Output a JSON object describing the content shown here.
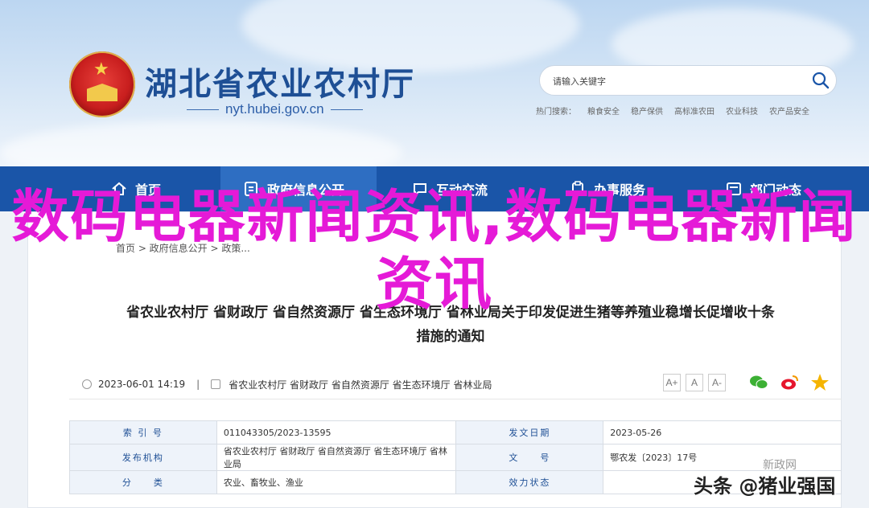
{
  "header": {
    "site_title": "湖北省农业农村厅",
    "domain": "nyt.hubei.gov.cn",
    "search_placeholder": "请输入关键字",
    "hot_search_label": "热门搜索：",
    "hot_search_items": [
      "粮食安全",
      "稳产保供",
      "高标准农田",
      "农业科技",
      "农产品安全"
    ]
  },
  "nav": {
    "items": [
      {
        "label": "首页"
      },
      {
        "label": "政府信息公开"
      },
      {
        "label": "互动交流"
      },
      {
        "label": "办事服务"
      },
      {
        "label": "部门动态"
      }
    ]
  },
  "breadcrumb": "首页 > 政府信息公开 > 政策...",
  "article": {
    "title_line1": "省农业农村厅 省财政厅 省自然资源厅 省生态环境厅 省林业局关于印发促进生猪等养殖业稳增长促增收十条",
    "title_line2": "措施的通知",
    "date": "2023-06-01 14:19",
    "divider": "|",
    "publishers": "省农业农村厅 省财政厅 省自然资源厅 省生态环境厅 省林业局",
    "font_buttons": [
      "A+",
      "A",
      "A-"
    ]
  },
  "info_table": [
    {
      "label1": "索 引 号",
      "value1": "011043305/2023-13595",
      "label2": "发文日期",
      "value2": "2023-05-26"
    },
    {
      "label1": "发布机构",
      "value1": "省农业农村厅 省财政厅 省自然资源厅 省生态环境厅 省林业局",
      "label2": "文　　号",
      "value2": "鄂农发〔2023〕17号"
    },
    {
      "label1": "分　　类",
      "value1": "农业、畜牧业、渔业",
      "label2": "效力状态",
      "value2": ""
    }
  ],
  "overlay_title": "数码电器新闻资讯,数码电器新闻资讯",
  "watermark_small": "新政网",
  "watermark": "头条 @猪业强国",
  "colors": {
    "nav_bg": "#1a55a8",
    "title_blue": "#1e4f95",
    "overlay": "#e51ad7"
  }
}
